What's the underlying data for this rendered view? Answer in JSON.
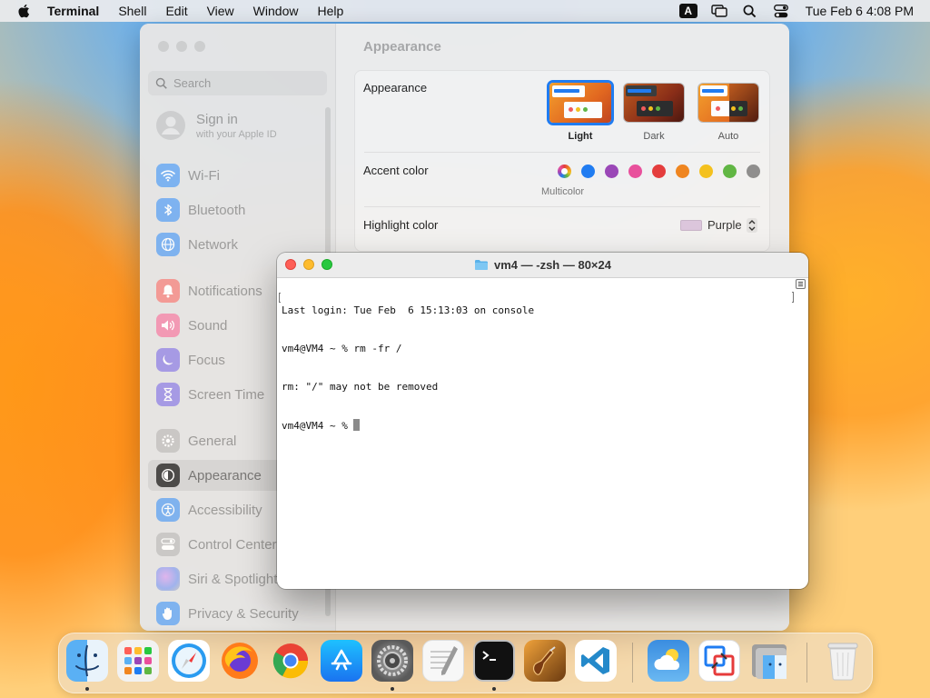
{
  "menubar": {
    "app_name": "Terminal",
    "menus": [
      "Shell",
      "Edit",
      "View",
      "Window",
      "Help"
    ],
    "input_badge": "A",
    "clock": "Tue Feb 6  4:08 PM"
  },
  "settings": {
    "search_placeholder": "Search",
    "signin": {
      "title": "Sign in",
      "subtitle": "with your Apple ID"
    },
    "sidebar": [
      {
        "label": "Wi-Fi",
        "icon": "wifi-icon",
        "color": "#3b8ff5"
      },
      {
        "label": "Bluetooth",
        "icon": "bluetooth-icon",
        "color": "#3b8ff5"
      },
      {
        "label": "Network",
        "icon": "globe-icon",
        "color": "#3b8ff5"
      },
      {
        "label": "Notifications",
        "icon": "bell-icon",
        "color": "#f25a55"
      },
      {
        "label": "Sound",
        "icon": "speaker-icon",
        "color": "#f25a88"
      },
      {
        "label": "Focus",
        "icon": "moon-icon",
        "color": "#6e5ad6"
      },
      {
        "label": "Screen Time",
        "icon": "hourglass-icon",
        "color": "#6e5ad6"
      },
      {
        "label": "General",
        "icon": "gear-icon",
        "color": "#9a9a9a"
      },
      {
        "label": "Appearance",
        "icon": "appearance-icon",
        "color": "#1a1a1a"
      },
      {
        "label": "Accessibility",
        "icon": "accessibility-icon",
        "color": "#3b8ff5"
      },
      {
        "label": "Control Center",
        "icon": "control-center-icon",
        "color": "#9a9a9a"
      },
      {
        "label": "Siri & Spotlight",
        "icon": "siri-icon",
        "color": "#b36ad9"
      },
      {
        "label": "Privacy & Security",
        "icon": "hand-icon",
        "color": "#3b8ff5"
      }
    ],
    "selected_item": "Appearance",
    "page_title": "Appearance",
    "appearance_label": "Appearance",
    "appearance_options": [
      "Light",
      "Dark",
      "Auto"
    ],
    "appearance_selected": "Light",
    "accent_label": "Accent color",
    "accent_colors": [
      "multicolor",
      "#1f7cf2",
      "#9b45b7",
      "#eb4f9b",
      "#e63b3b",
      "#f1851e",
      "#f6c21c",
      "#5fb743",
      "#8e8e8e"
    ],
    "accent_selected_label": "Multicolor",
    "highlight_label": "Highlight color",
    "highlight_value": "Purple"
  },
  "terminal": {
    "title": "vm4 — -zsh — 80×24",
    "lines": [
      "Last login: Tue Feb  6 15:13:03 on console",
      "vm4@VM4 ~ % rm -fr /",
      "rm: \"/\" may not be removed",
      "vm4@VM4 ~ % "
    ]
  },
  "dock": {
    "apps": [
      {
        "name": "finder",
        "running": true
      },
      {
        "name": "launchpad",
        "running": false
      },
      {
        "name": "safari",
        "running": false
      },
      {
        "name": "firefox",
        "running": false
      },
      {
        "name": "chrome",
        "running": false
      },
      {
        "name": "app-store",
        "running": false
      },
      {
        "name": "system-settings",
        "running": true
      },
      {
        "name": "textedit",
        "running": false
      },
      {
        "name": "terminal",
        "running": true
      },
      {
        "name": "garageband",
        "running": false
      },
      {
        "name": "vscode",
        "running": false
      },
      {
        "name": "weather",
        "running": false
      },
      {
        "name": "screen-sharing",
        "running": false
      },
      {
        "name": "finder-folder",
        "running": false
      },
      {
        "name": "trash",
        "running": false
      }
    ]
  }
}
